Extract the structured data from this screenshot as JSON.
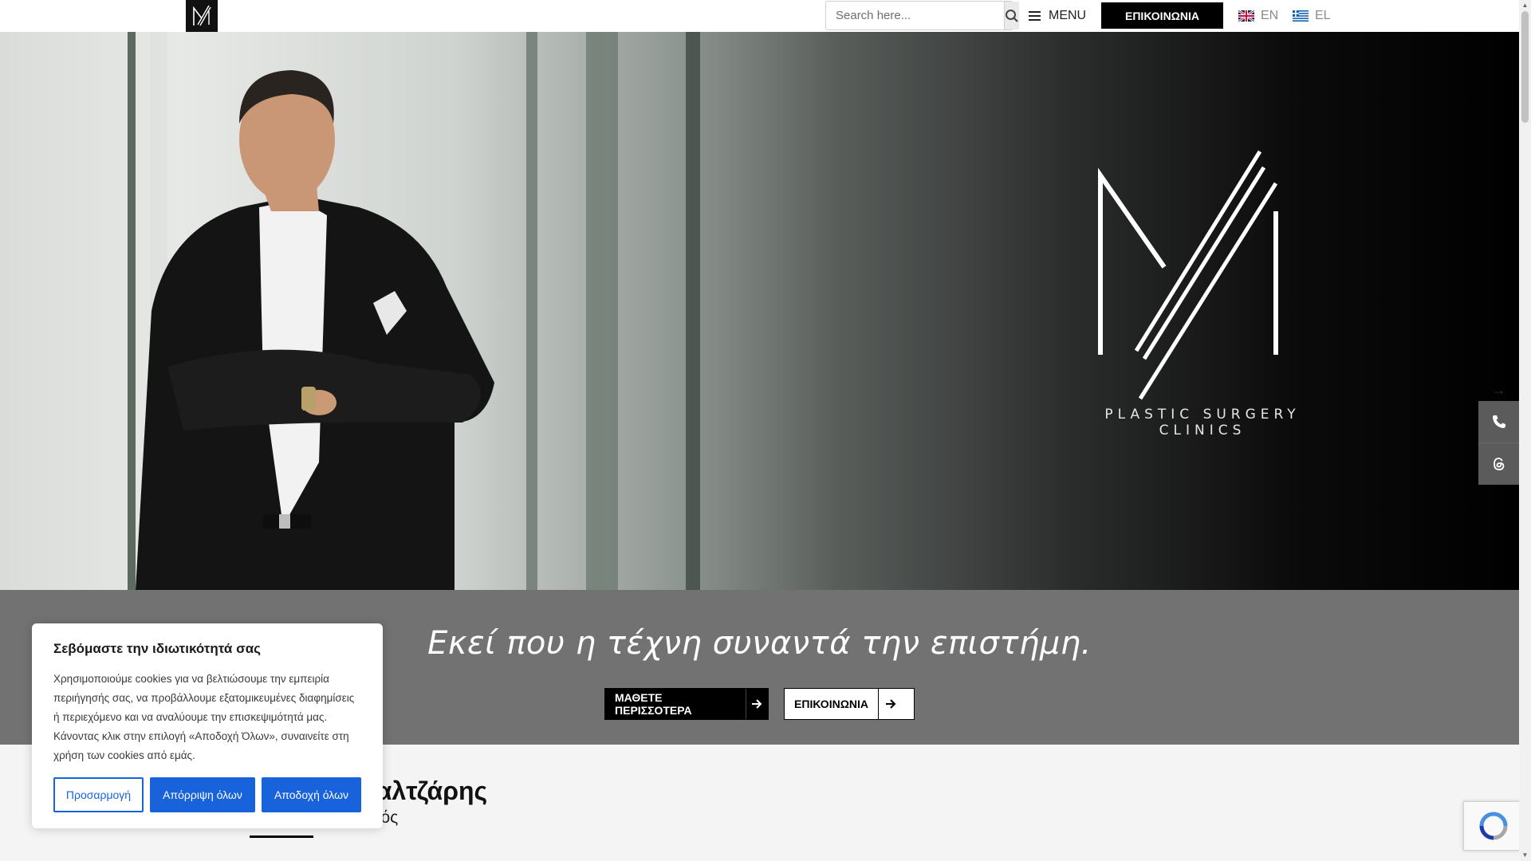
{
  "header": {
    "search_placeholder": "Search here...",
    "menu_label": "MENU",
    "contact_label": "ΕΠΙΚΟΙΝΩΝΙΑ",
    "languages": [
      {
        "code": "EN",
        "flag": "uk-flag-icon"
      },
      {
        "code": "EL",
        "flag": "greek-flag-icon"
      }
    ]
  },
  "hero": {
    "brand_tagline": "PLASTIC SURGERY CLINICS"
  },
  "side_widgets": {
    "arrow": "→",
    "items": [
      "phone-icon",
      "threads-icon"
    ]
  },
  "band": {
    "tagline": "Εκεί που η τέχνη συναντά την επιστήμη.",
    "cta_learn_more": "ΜΑΘΕΤΕ ΠΕΡΙΣΣΟΤΕΡΑ",
    "cta_contact": "ΕΠΙΚΟΙΝΩΝΙΑ"
  },
  "lower": {
    "name_visible": "ος Μαλτζάρης",
    "role_visible": "ργός"
  },
  "cookie": {
    "title": "Σεβόμαστε την ιδιωτικότητά σας",
    "text": "Χρησιμοποιούμε cookies για να βελτιώσουμε την εμπειρία περιήγησής σας, να προβάλλουμε εξατομικευμένες διαφημίσεις ή περιεχόμενο και να αναλύουμε την επισκεψιμότητά μας. Κάνοντας κλικ στην επιλογή «Αποδοχή Όλων», συναινείτε στη χρήση των cookies από εμάς.",
    "customize": "Προσαρμογή",
    "reject": "Απόρριψη όλων",
    "accept": "Αποδοχή όλων"
  },
  "colors": {
    "accent_blue": "#1863dc",
    "band_gray": "#727272",
    "black": "#000000"
  }
}
